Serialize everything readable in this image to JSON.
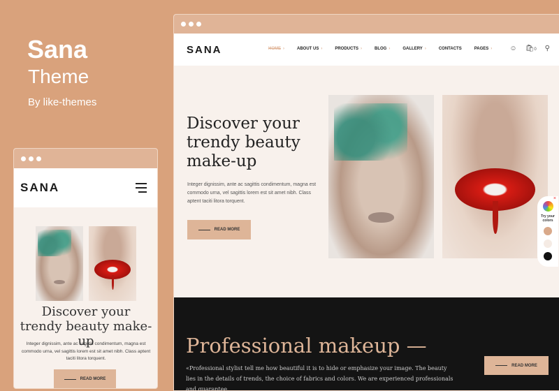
{
  "promo": {
    "title": "Sana",
    "subtitle": "Theme",
    "byline": "By like-themes"
  },
  "desktop": {
    "logo": "SANA",
    "nav": [
      {
        "label": "HOME",
        "active": true,
        "chevron": true
      },
      {
        "label": "ABOUT US",
        "chevron": true
      },
      {
        "label": "PRODUCTS",
        "chevron": true
      },
      {
        "label": "BLOG",
        "chevron": true
      },
      {
        "label": "GALLERY",
        "chevron": true
      },
      {
        "label": "CONTACTS",
        "chevron": false
      },
      {
        "label": "PAGES",
        "chevron": true
      }
    ],
    "cart_count": "0",
    "hero": {
      "heading": "Discover your trendy beauty make-up",
      "text": "Integer dignissim, ante ac sagittis condimentum, magna est commodo urna, vel sagittis lorem est sit amet nibh. Class aptent taciti litora torquent.",
      "button": "READ MORE"
    },
    "section": {
      "heading": "Professional makeup —",
      "text": "«Professional stylist tell me how beautiful it is to hide or emphasize your image. The beauty lies in the details of trends, the choice of fabrics and colors. We are experienced professionals and guarantee",
      "button": "READ MORE"
    },
    "picker": {
      "label": "Try your colors",
      "swatches": [
        "#d9a98a",
        "#f5ebe4",
        "#111111"
      ]
    }
  },
  "mobile": {
    "logo": "SANA",
    "hero": {
      "heading": "Discover your trendy beauty make-up",
      "text": "Integer dignissim, ante ac sagittis condimentum, magna est commodo urna, vel sagittis lorem est sit amet nibh. Class aptent taciti litora torquent.",
      "button": "READ MORE"
    }
  }
}
